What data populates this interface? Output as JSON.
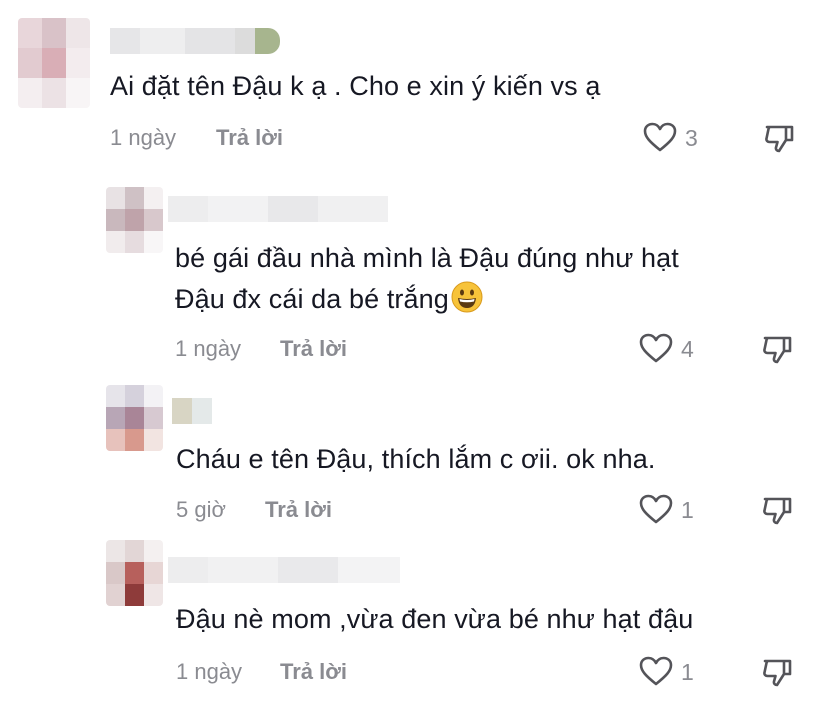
{
  "comments": [
    {
      "text": "Ai đặt tên Đậu k ạ . Cho e xin ý kiến vs ạ",
      "time": "1 ngày",
      "reply_label": "Trả lời",
      "likes": "3",
      "like_icon": "heart-outline-icon",
      "dislike_icon": "thumbs-down-icon"
    },
    {
      "text": "bé gái đầu nhà mình là Đậu đúng như hạt",
      "text_line2": "Đậu đx cái da bé trắng",
      "emoji": "grinning-face-emoji",
      "time": "1 ngày",
      "reply_label": "Trả lời",
      "likes": "4",
      "like_icon": "heart-outline-icon",
      "dislike_icon": "thumbs-down-icon"
    },
    {
      "text": "Cháu e tên Đậu, thích lắm c ơii. ok nha.",
      "time": "5 giờ",
      "reply_label": "Trả lời",
      "likes": "1",
      "like_icon": "heart-outline-icon",
      "dislike_icon": "thumbs-down-icon"
    },
    {
      "text": "Đậu nè mom ,vừa đen vừa bé như hạt đậu",
      "time": "1 ngày",
      "reply_label": "Trả lời",
      "likes": "1",
      "like_icon": "heart-outline-icon",
      "dislike_icon": "thumbs-down-icon"
    }
  ],
  "colors": {
    "text": "#161823",
    "secondary": "#8a8b91",
    "icon": "#545459"
  }
}
